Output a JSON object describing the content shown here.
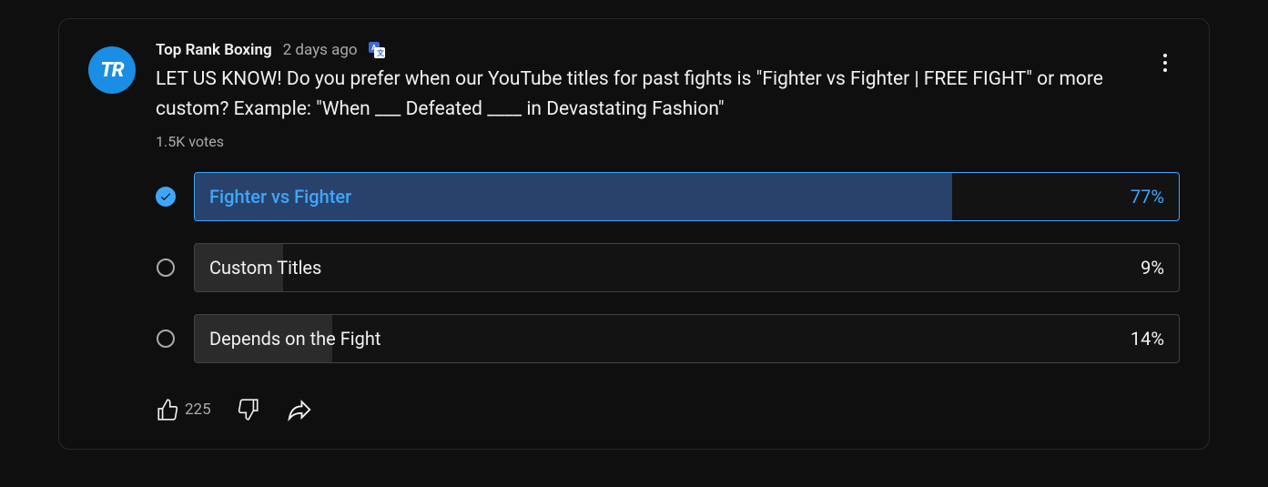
{
  "avatar_initials": "TR",
  "channel_name": "Top Rank Boxing",
  "timestamp": "2 days ago",
  "post_text": "LET US KNOW! Do you prefer when our YouTube titles for past fights is \"Fighter vs Fighter | FREE FIGHT\" or more custom? Example: \"When ___ Defeated ____ in Devastating Fashion\"",
  "votes_count": "1.5K votes",
  "options": [
    {
      "label": "Fighter vs Fighter",
      "pct": "77%",
      "fill": 77,
      "selected": true
    },
    {
      "label": "Custom Titles",
      "pct": "9%",
      "fill": 9,
      "selected": false
    },
    {
      "label": "Depends on the Fight",
      "pct": "14%",
      "fill": 14,
      "selected": false
    }
  ],
  "like_count": "225"
}
